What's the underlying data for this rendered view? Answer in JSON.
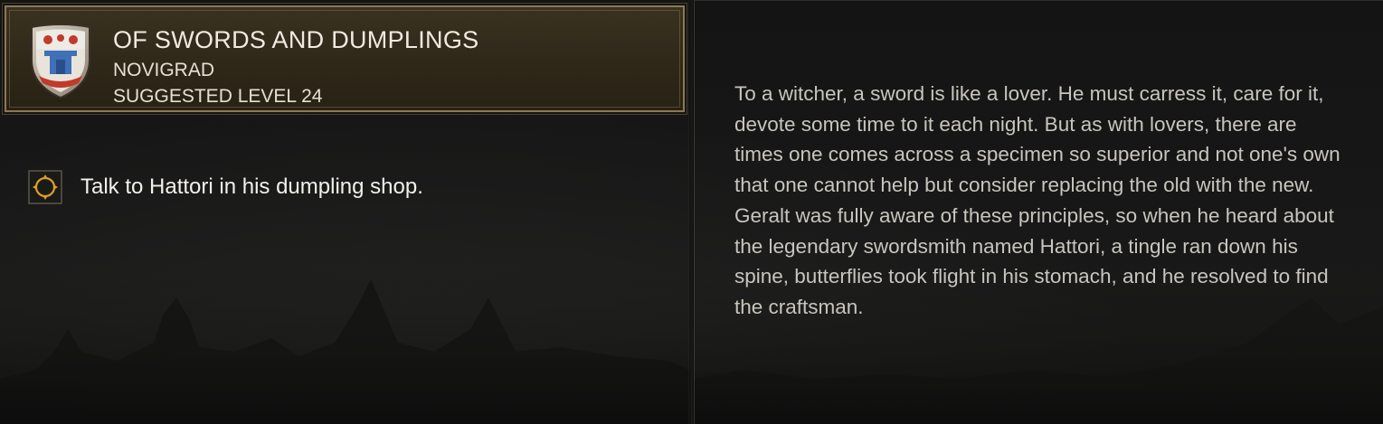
{
  "quest": {
    "title": "OF SWORDS AND DUMPLINGS",
    "region": "NOVIGRAD",
    "suggested_level": "SUGGESTED LEVEL 24",
    "emblem_icon": "novigrad-crest-icon"
  },
  "objectives": [
    {
      "icon": "objective-target-icon",
      "text": "Talk to Hattori in his dumpling shop."
    }
  ],
  "description": "To a witcher, a sword is like a lover. He must carress it, care for it, devote some time to it each night. But as with lovers, there are times one comes across a specimen so superior and not one's own that one cannot help but consider replacing the old with the new. Geralt was fully aware of these principles, so when he heard about the legendary swordsmith named Hattori, a tingle ran down his spine, butterflies took flight in his stomach, and he resolved to find the craftsman.",
  "colors": {
    "header_gold": "#8c7a55",
    "objective_accent": "#e0a020",
    "text_light": "#f0ebe0",
    "text_desc": "#c8c5be"
  }
}
